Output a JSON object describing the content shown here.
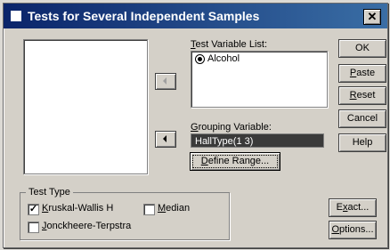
{
  "window": {
    "title": "Tests for Several Independent Samples",
    "close_glyph": "✕"
  },
  "test_variable_list": {
    "label": "Test Variable List:",
    "items": [
      "Alcohol"
    ]
  },
  "grouping_variable": {
    "label": "Grouping Variable:",
    "value": "HallType(1 3)"
  },
  "define_range_label": "Define Range...",
  "buttons": {
    "ok": "OK",
    "paste": "Paste",
    "reset": "Reset",
    "cancel": "Cancel",
    "help": "Help",
    "exact": "Exact...",
    "options": "Options..."
  },
  "test_type": {
    "legend": "Test Type",
    "options": [
      {
        "label": "Kruskal-Wallis H",
        "checked": true
      },
      {
        "label": "Median",
        "checked": false
      },
      {
        "label": "Jonckheere-Terpstra",
        "checked": false
      }
    ]
  },
  "icons": {
    "app": "window-icon",
    "arrow": "arrow-left-icon",
    "variable": "scale-variable-icon"
  }
}
